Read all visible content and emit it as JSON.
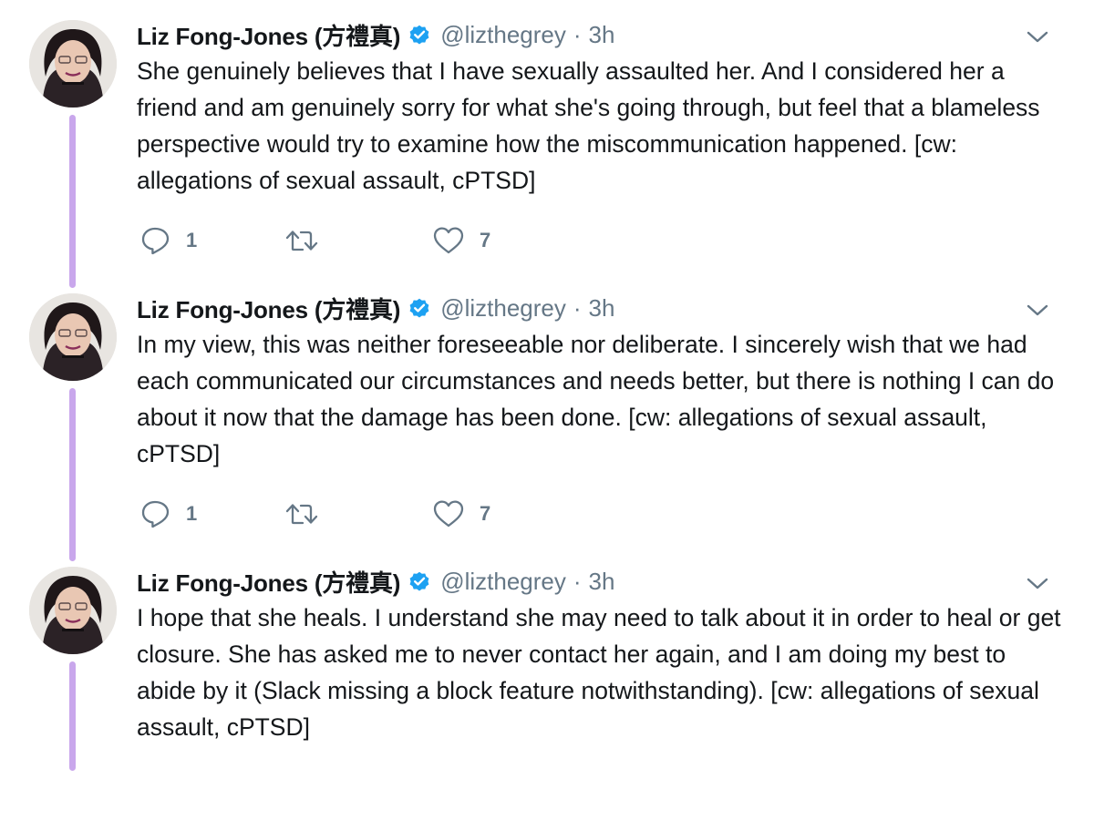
{
  "author": {
    "name": "Liz Fong-Jones (方禮真)",
    "handle": "@lizthegrey",
    "separator": "·"
  },
  "colors": {
    "verified": "#1da1f2",
    "thread_line": "#c9a7ec",
    "icon_gray": "#657786",
    "text": "#14171a"
  },
  "tweets": [
    {
      "time": "3h",
      "text": "She genuinely believes that I have sexually assaulted her. And I considered her a friend and am genuinely sorry for what she's going through, but feel that a blameless perspective would try to examine how the miscommunication happened. [cw: allegations of sexual assault, cPTSD]",
      "replies": "1",
      "retweets": "",
      "likes": "7"
    },
    {
      "time": "3h",
      "text": "In my view, this was neither foreseeable nor deliberate. I sincerely wish that we had each communicated our circumstances and needs better, but there is nothing I can do about it now that the damage has been done. [cw: allegations of sexual assault, cPTSD]",
      "replies": "1",
      "retweets": "",
      "likes": "7"
    },
    {
      "time": "3h",
      "text": "I hope that she heals. I understand she may need to talk about it in order to heal or get closure. She has asked me to never contact her again, and I am doing my best to abide by it (Slack missing a block feature notwithstanding). [cw: allegations of sexual assault, cPTSD]",
      "replies": "",
      "retweets": "",
      "likes": ""
    }
  ]
}
